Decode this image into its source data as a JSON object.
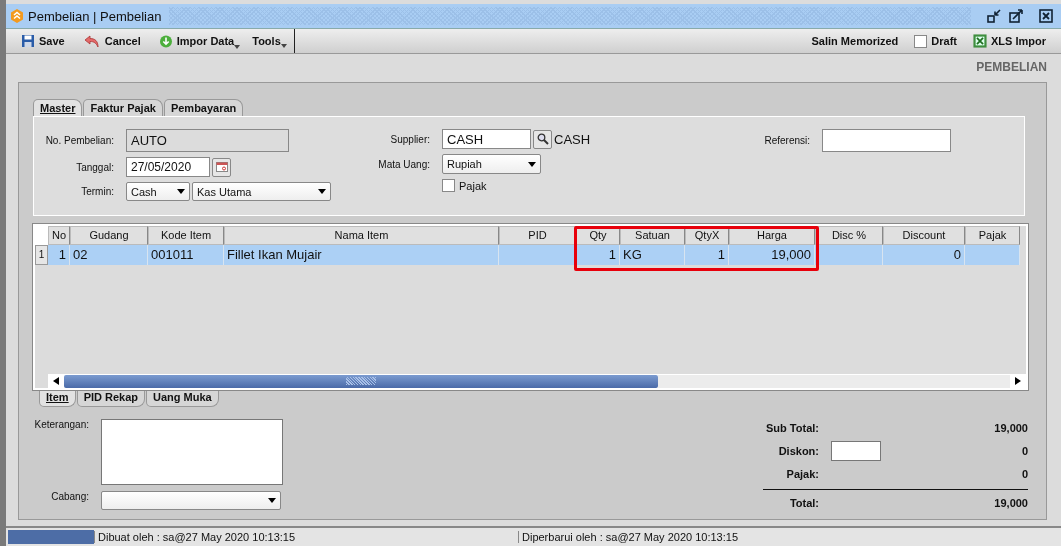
{
  "window": {
    "title": "Pembelian | Pembelian"
  },
  "toolbar": {
    "left": [
      {
        "label": "Save",
        "kind": "save"
      },
      {
        "label": "Cancel",
        "kind": "cancel"
      },
      {
        "label": "Impor Data",
        "kind": "import",
        "dropdown": true
      },
      {
        "label": "Tools",
        "kind": "plain",
        "dropdown": true
      }
    ],
    "right": {
      "copy": "Salin Memorized",
      "draft": {
        "label": "Draft",
        "checked": false
      },
      "xls": "XLS Impor"
    }
  },
  "page_title": "PEMBELIAN",
  "tabs": [
    {
      "label": "Master",
      "selected": true
    },
    {
      "label": "Faktur Pajak",
      "selected": false
    },
    {
      "label": "Pembayaran",
      "selected": false
    }
  ],
  "master": {
    "no_pembelian": {
      "label": "No. Pembelian:",
      "value": "AUTO"
    },
    "tanggal": {
      "label": "Tanggal:",
      "value": "27/05/2020"
    },
    "termin": {
      "label": "Termin:",
      "value": "Cash",
      "account": "Kas Utama"
    },
    "supplier": {
      "label": "Supplier:",
      "value": "CASH",
      "name": "CASH"
    },
    "mata_uang": {
      "label": "Mata Uang:",
      "value": "Rupiah"
    },
    "pajak": {
      "label": "Pajak",
      "checked": false
    },
    "referensi": {
      "label": "Referensi:"
    }
  },
  "table": {
    "columns": [
      {
        "label": "No",
        "highlighted": false
      },
      {
        "label": "Gudang",
        "highlighted": false
      },
      {
        "label": "Kode Item",
        "highlighted": false
      },
      {
        "label": "Nama Item",
        "highlighted": false
      },
      {
        "label": "PID",
        "highlighted": false
      },
      {
        "label": "Qty",
        "highlighted": true
      },
      {
        "label": "Satuan",
        "highlighted": true
      },
      {
        "label": "QtyX",
        "highlighted": true
      },
      {
        "label": "Harga",
        "highlighted": true
      },
      {
        "label": "Disc %",
        "highlighted": false
      },
      {
        "label": "Discount",
        "highlighted": false
      },
      {
        "label": "Pajak",
        "highlighted": false
      }
    ],
    "rows": [
      {
        "header": "1",
        "selected": true,
        "cells": [
          "1",
          "02",
          "001011",
          "Fillet Ikan Mujair",
          "",
          "1",
          "KG",
          "1",
          "19,000",
          "",
          "0",
          ""
        ]
      }
    ]
  },
  "bottom_tabs": [
    {
      "label": "Item",
      "selected": true
    },
    {
      "label": "PID Rekap",
      "selected": false
    },
    {
      "label": "Uang Muka",
      "selected": false
    }
  ],
  "keterangan": {
    "label": "Keterangan:"
  },
  "cabang": {
    "label": "Cabang:"
  },
  "totals": {
    "sub_total": {
      "label": "Sub Total:",
      "value": "19,000"
    },
    "diskon": {
      "label": "Diskon:",
      "value": "0"
    },
    "pajak": {
      "label": "Pajak:",
      "value": "0"
    },
    "total": {
      "label": "Total:",
      "value": "19,000"
    }
  },
  "status_bar": {
    "created": "Dibuat oleh : sa@27 May 2020  10:13:15",
    "updated": "Diperbarui oleh : sa@27 May 2020  10:13:15"
  }
}
